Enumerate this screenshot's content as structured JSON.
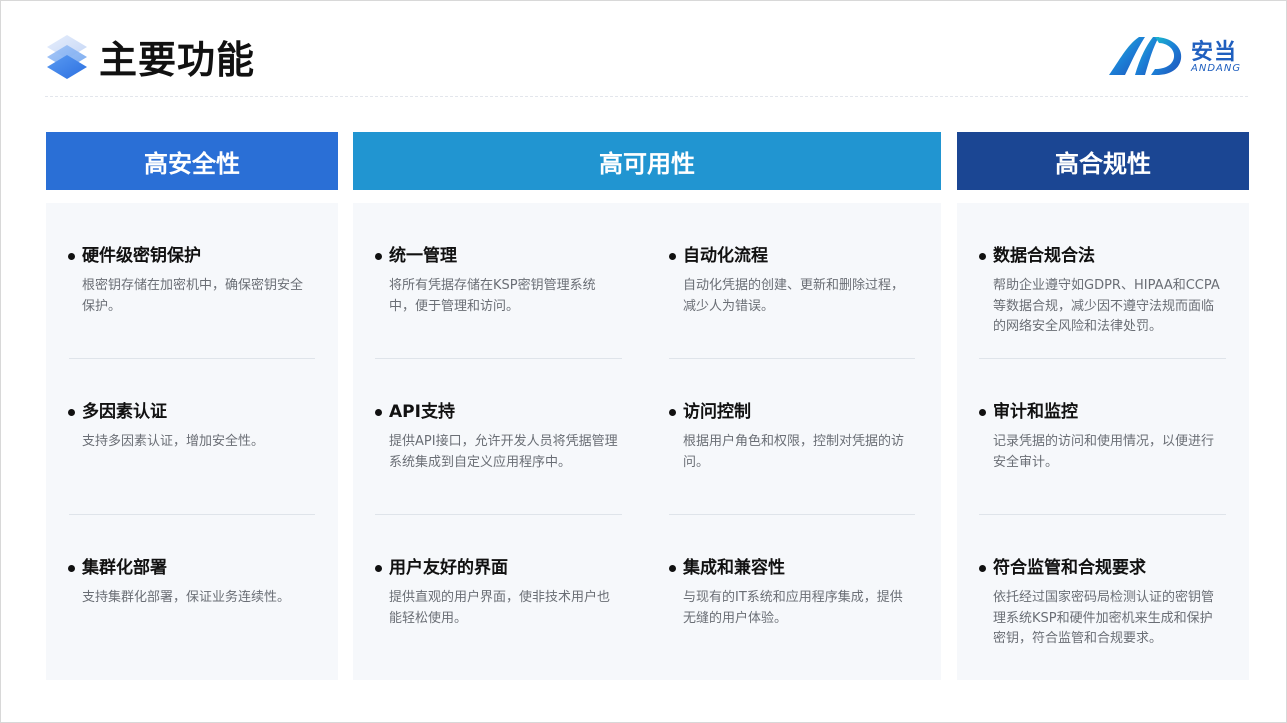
{
  "header": {
    "title": "主要功能",
    "logo": {
      "name": "安当",
      "sub": "ANDANG",
      "brand_color": "#1f5fbf"
    }
  },
  "colors": {
    "security": "#2a6fd6",
    "availability": "#2195d1",
    "compliance": "#1b4693",
    "panel": "#f6f8fb"
  },
  "columns": [
    {
      "title": "高安全性",
      "items": [
        {
          "title": "硬件级密钥保护",
          "desc": "根密钥存储在加密机中，确保密钥安全保护。"
        },
        {
          "title": "多因素认证",
          "desc": "支持多因素认证，增加安全性。"
        },
        {
          "title": "集群化部署",
          "desc": "支持集群化部署，保证业务连续性。"
        }
      ]
    },
    {
      "title": "高可用性",
      "items": [
        {
          "title": "统一管理",
          "desc": "将所有凭据存储在KSP密钥管理系统中，便于管理和访问。"
        },
        {
          "title": "自动化流程",
          "desc": "自动化凭据的创建、更新和删除过程，减少人为错误。"
        },
        {
          "title": "API支持",
          "desc": "提供API接口，允许开发人员将凭据管理系统集成到自定义应用程序中。"
        },
        {
          "title": "访问控制",
          "desc": "根据用户角色和权限，控制对凭据的访问。"
        },
        {
          "title": "用户友好的界面",
          "desc": "提供直观的用户界面，使非技术用户也能轻松使用。"
        },
        {
          "title": "集成和兼容性",
          "desc": "与现有的IT系统和应用程序集成，提供无缝的用户体验。"
        }
      ]
    },
    {
      "title": "高合规性",
      "items": [
        {
          "title": "数据合规合法",
          "desc": "帮助企业遵守如GDPR、HIPAA和CCPA等数据合规，减少因不遵守法规而面临的网络安全风险和法律处罚。"
        },
        {
          "title": "审计和监控",
          "desc": "记录凭据的访问和使用情况，以便进行安全审计。"
        },
        {
          "title": "符合监管和合规要求",
          "desc": "依托经过国家密码局检测认证的密钥管理系统KSP和硬件加密机来生成和保护密钥，符合监管和合规要求。"
        }
      ]
    }
  ]
}
